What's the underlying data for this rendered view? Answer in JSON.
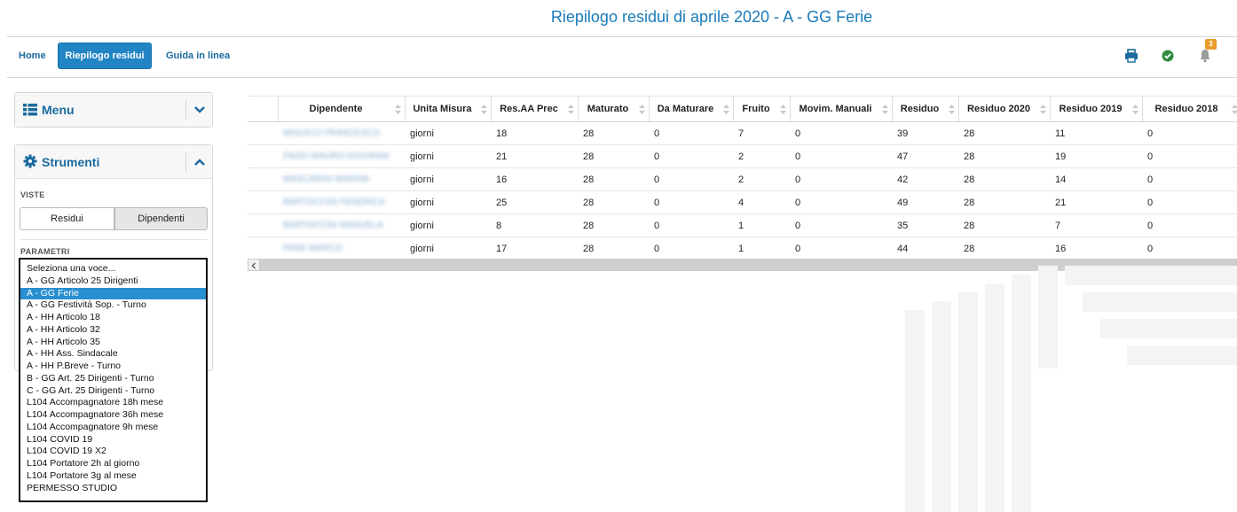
{
  "header": {
    "title": "Riepilogo residui di aprile 2020 - A - GG Ferie"
  },
  "nav": {
    "home": "Home",
    "active": "Riepilogo residui",
    "help": "Guida in linea",
    "notifications_count": "3"
  },
  "sidebar": {
    "menu_title": "Menu",
    "tools_title": "Strumenti",
    "views_label": "VISTE",
    "view_residui": "Residui",
    "view_dipendenti": "Dipendenti",
    "params_label": "PARAMETRI",
    "options": [
      "Seleziona una voce...",
      "A - GG Articolo 25 Dirigenti",
      "A - GG Ferie",
      "A - GG Festività Sop. - Turno",
      "A - HH Articolo 18",
      "A - HH Articolo 32",
      "A - HH Articolo 35",
      "A - HH Ass. Sindacale",
      "A - HH P.Breve - Turno",
      "B - GG Art. 25 Dirigenti - Turno",
      "C - GG Art. 25 Dirigenti - Turno",
      "L104 Accompagnatore 18h mese",
      "L104 Accompagnatore 36h mese",
      "L104 Accompagnatore 9h mese",
      "L104 COVID 19",
      "L104 COVID 19 X2",
      "L104 Portatore 2h al giorno",
      "L104 Portatore 3g al mese",
      "PERMESSO STUDIO"
    ],
    "selected": "A - GG Ferie"
  },
  "table": {
    "columns": [
      "Dipendente",
      "Unita Misura",
      "Res.AA Prec",
      "Maturato",
      "Da Maturare",
      "Fruito",
      "Movim. Manuali",
      "Residuo",
      "Residuo 2020",
      "Residuo 2019",
      "Residuo 2018"
    ],
    "rows": [
      [
        "MIGUCCI FRANCESCO",
        "giorni",
        "18",
        "28",
        "0",
        "7",
        "0",
        "39",
        "28",
        "11",
        "0"
      ],
      [
        "FAZIO MAURO GIOVANNI",
        "giorni",
        "21",
        "28",
        "0",
        "2",
        "0",
        "47",
        "28",
        "19",
        "0"
      ],
      [
        "MASCARINI MARINA",
        "giorni",
        "16",
        "28",
        "0",
        "2",
        "0",
        "42",
        "28",
        "14",
        "0"
      ],
      [
        "BARTOCCINI FEDERICA",
        "giorni",
        "25",
        "28",
        "0",
        "4",
        "0",
        "49",
        "28",
        "21",
        "0"
      ],
      [
        "BARTOCCINI MANUELA",
        "giorni",
        "8",
        "28",
        "0",
        "1",
        "0",
        "35",
        "28",
        "7",
        "0"
      ],
      [
        "PANE MARCO",
        "giorni",
        "17",
        "28",
        "0",
        "1",
        "0",
        "44",
        "28",
        "16",
        "0"
      ]
    ]
  },
  "colors": {
    "accent": "#2185c5",
    "title": "#1a7bb9",
    "badge": "#e89b2b",
    "ok": "#2e8b3e"
  },
  "icons": {
    "print": "print-icon",
    "ok": "check-circle-icon",
    "bell": "bell-icon",
    "menu": "list-icon",
    "tools": "gear-icon"
  }
}
